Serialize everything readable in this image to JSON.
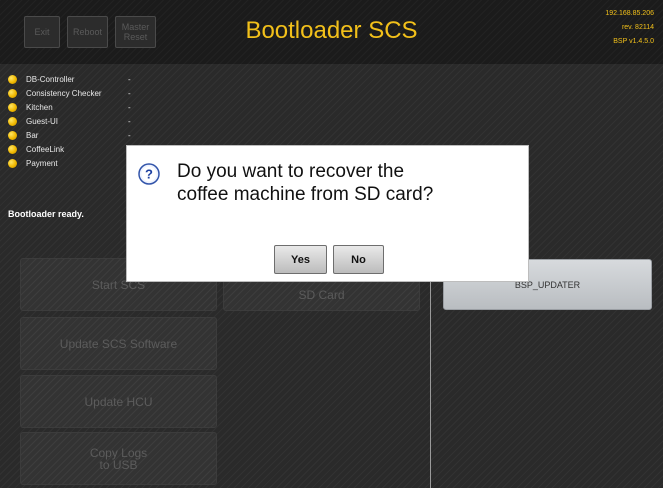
{
  "header": {
    "exit_label": "Exit",
    "reboot_label": "Reboot",
    "master_reset_line1": "Master",
    "master_reset_line2": "Reset",
    "title": "Bootloader SCS",
    "ip": "192.168.85.206",
    "rev": "rev. 82114",
    "bsp": "BSP v1.4.5.0"
  },
  "status": [
    {
      "name": "DB-Controller",
      "value": "-"
    },
    {
      "name": "Consistency Checker",
      "value": "-"
    },
    {
      "name": "Kitchen",
      "value": "-"
    },
    {
      "name": "Guest-UI",
      "value": "-"
    },
    {
      "name": "Bar",
      "value": "-"
    },
    {
      "name": "CoffeeLink",
      "value": "-"
    },
    {
      "name": "Payment",
      "value": "-"
    }
  ],
  "ready_text": "Bootloader ready.",
  "buttons": {
    "start_scs": "Start SCS",
    "sd_card": "SD Card",
    "update_scs": "Update SCS Software",
    "update_hcu": "Update HCU",
    "copy_logs_line1": "Copy Logs",
    "copy_logs_line2": "to USB",
    "bsp_updater": "BSP_UPDATER"
  },
  "dialog": {
    "line1": "Do you want to recover the",
    "line2": "coffee machine from SD card?",
    "yes": "Yes",
    "no": "No"
  },
  "colors": {
    "accent": "#f2c01a",
    "status_dot": "#f0b800"
  }
}
